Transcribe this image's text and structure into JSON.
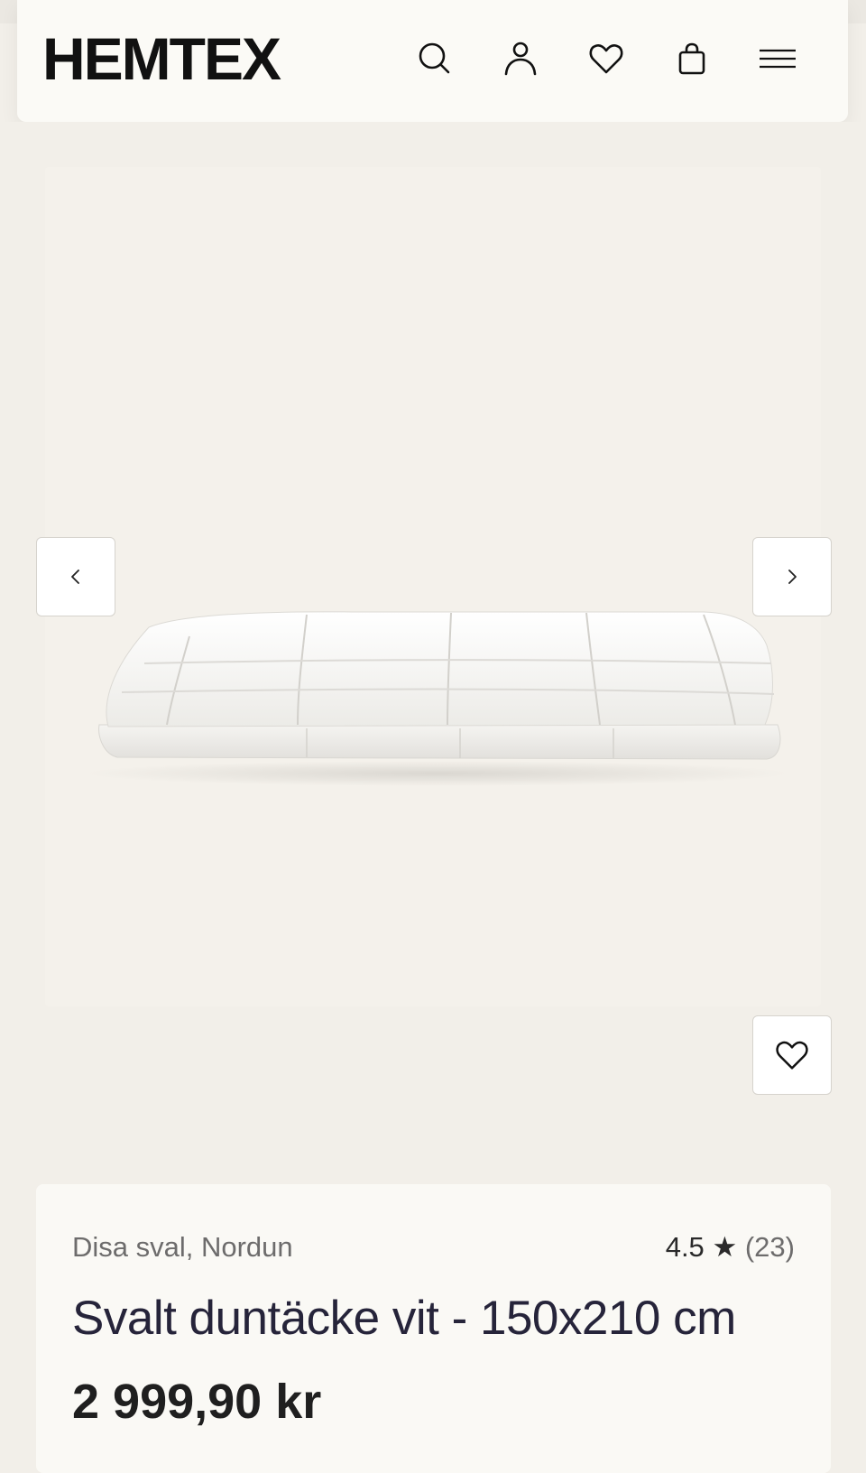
{
  "header": {
    "logo": "HEMTEX",
    "icons": [
      "search-icon",
      "account-icon",
      "heart-icon",
      "bag-icon",
      "menu-icon"
    ]
  },
  "gallery": {
    "image_alt": "Svalt duntäcke vit",
    "prev_icon": "chevron-left-icon",
    "next_icon": "chevron-right-icon",
    "favorite_icon": "heart-icon"
  },
  "product": {
    "brand": "Disa sval, Nordun",
    "rating_value": "4.5",
    "rating_star": "★",
    "rating_count": "(23)",
    "title": "Svalt duntäcke vit - 150x210 cm",
    "price": "2 999,90 kr"
  },
  "colors": {
    "page_bg": "#f2efe9",
    "header_bg": "#fbfaf6",
    "card_bg": "#faf9f5",
    "text_dark": "#1f1f28",
    "text_muted": "#6d6c6c"
  }
}
